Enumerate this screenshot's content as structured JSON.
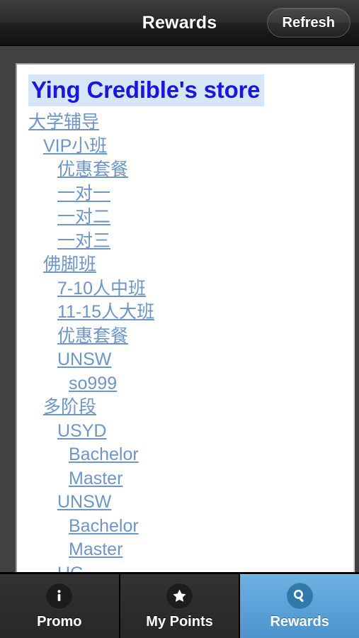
{
  "header": {
    "title": "Rewards",
    "refresh_label": "Refresh"
  },
  "content": {
    "store_title": "Ying Credible's store",
    "tree": [
      {
        "label": "大学辅导",
        "level": 0
      },
      {
        "label": "VIP小班",
        "level": 1
      },
      {
        "label": "优惠套餐",
        "level": 2
      },
      {
        "label": "一对一",
        "level": 2
      },
      {
        "label": "一对二",
        "level": 2
      },
      {
        "label": "一对三",
        "level": 2
      },
      {
        "label": "佛脚班",
        "level": 1
      },
      {
        "label": "7-10人中班",
        "level": 2
      },
      {
        "label": "11-15人大班",
        "level": 2
      },
      {
        "label": "优惠套餐",
        "level": 2
      },
      {
        "label": "UNSW",
        "level": 2
      },
      {
        "label": "so999",
        "level": 3
      },
      {
        "label": "多阶段",
        "level": 1
      },
      {
        "label": "USYD",
        "level": 2
      },
      {
        "label": "Bachelor",
        "level": 3
      },
      {
        "label": "Master",
        "level": 3
      },
      {
        "label": "UNSW",
        "level": 2
      },
      {
        "label": "Bachelor",
        "level": 3
      },
      {
        "label": "Master",
        "level": 3
      },
      {
        "label": "UG",
        "level": 2
      }
    ]
  },
  "tabs": [
    {
      "label": "Promo",
      "icon": "info-icon",
      "active": false
    },
    {
      "label": "My Points",
      "icon": "star-icon",
      "active": false
    },
    {
      "label": "Rewards",
      "icon": "search-icon",
      "active": true
    }
  ],
  "colors": {
    "title_text": "#1a16e0",
    "title_highlight": "#d6e6f7",
    "link": "#6d95c6",
    "active_tab": "#5ba3d9",
    "chrome": "#2b2b2b",
    "body_bg": "#424242"
  }
}
